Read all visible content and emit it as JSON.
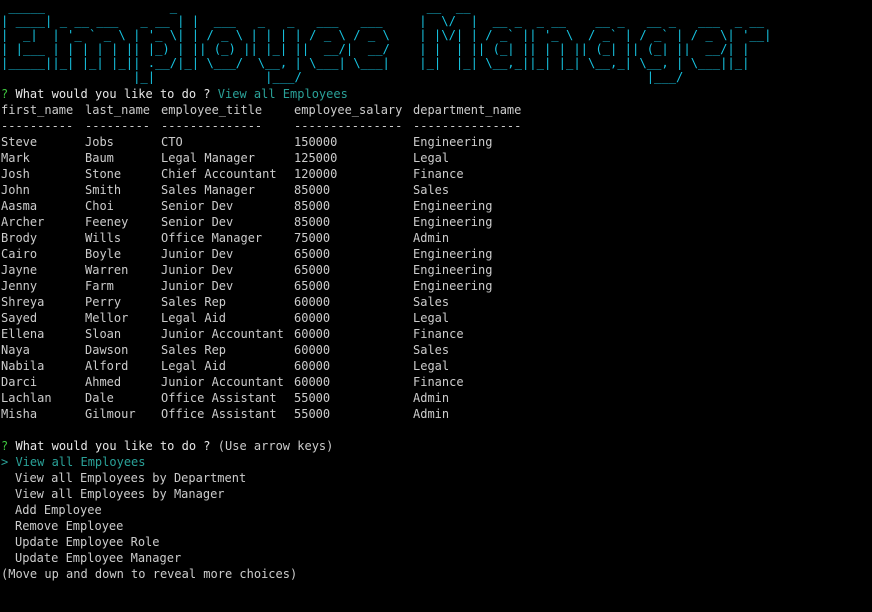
{
  "banner": {
    "lines": [
      " _____                 _                                  __  __",
      "| ____| _ __ ___   _ __ | |  ___   _   _   ___   ___     |  \\/  |  __ _  _ __    __ _   __ _   ___  _ __",
      "|  _|  | '_ ` _ \\ | '_ \\| | / _ \\ | | | | / _ \\ / _ \\    | |\\/| | / _` || '_ \\  / _` | / _` | / _ \\| '__|",
      "| |___ | | | | | || |_) | || (_) || |_| ||  __/|  __/    | |  | || (_| || | | || (_| || (_| ||  __/| |",
      "|_____||_| |_| |_|| .__/|_| \\___/  \\__, | \\___| \\___|    |_|  |_| \\__,_||_| |_| \\__,_| \\__, | \\___||_|",
      "                  |_|               |___/                                               |___/"
    ]
  },
  "prompt1": {
    "mark": "?",
    "question": "What would you like to do ?",
    "answer": "View all Employees"
  },
  "table": {
    "headers": [
      "first_name",
      "last_name",
      "employee_title",
      "employee_salary",
      "department_name"
    ],
    "dividers": [
      "----------",
      "---------",
      "--------------",
      "---------------",
      "---------------"
    ],
    "rows": [
      [
        "Steve",
        "Jobs",
        "CTO",
        "150000",
        "Engineering"
      ],
      [
        "Mark",
        "Baum",
        "Legal Manager",
        "125000",
        "Legal"
      ],
      [
        "Josh",
        "Stone",
        "Chief Accountant",
        "120000",
        "Finance"
      ],
      [
        "John",
        "Smith",
        "Sales Manager",
        "85000",
        "Sales"
      ],
      [
        "Aasma",
        "Choi",
        "Senior Dev",
        "85000",
        "Engineering"
      ],
      [
        "Archer",
        "Feeney",
        "Senior Dev",
        "85000",
        "Engineering"
      ],
      [
        "Brody",
        "Wills",
        "Office Manager",
        "75000",
        "Admin"
      ],
      [
        "Cairo",
        "Boyle",
        "Junior Dev",
        "65000",
        "Engineering"
      ],
      [
        "Jayne",
        "Warren",
        "Junior Dev",
        "65000",
        "Engineering"
      ],
      [
        "Jenny",
        "Farm",
        "Junior Dev",
        "65000",
        "Engineering"
      ],
      [
        "Shreya",
        "Perry",
        "Sales Rep",
        "60000",
        "Sales"
      ],
      [
        "Sayed",
        "Mellor",
        "Legal Aid",
        "60000",
        "Legal"
      ],
      [
        "Ellena",
        "Sloan",
        "Junior Accountant",
        "60000",
        "Finance"
      ],
      [
        "Naya",
        "Dawson",
        "Sales Rep",
        "60000",
        "Sales"
      ],
      [
        "Nabila",
        "Alford",
        "Legal Aid",
        "60000",
        "Legal"
      ],
      [
        "Darci",
        "Ahmed",
        "Junior Accountant",
        "60000",
        "Finance"
      ],
      [
        "Lachlan",
        "Dale",
        "Office Assistant",
        "55000",
        "Admin"
      ],
      [
        "Misha",
        "Gilmour",
        "Office Assistant",
        "55000",
        "Admin"
      ]
    ]
  },
  "prompt2": {
    "mark": "?",
    "question": "What would you like to do ?",
    "hint": "(Use arrow keys)"
  },
  "menu": {
    "pointer": ">",
    "choices": [
      "View all Employees",
      "View all Employees by Department",
      "View all Employees by Manager",
      "Add Employee",
      "Remove Employee",
      "Update Employee Role",
      "Update Employee Manager"
    ],
    "footer": "(Move up and down to reveal more choices)"
  },
  "colors": {
    "banner": "#17c3e0",
    "question_mark": "#3ec33e",
    "selected": "#2aa198",
    "text": "#cccccc",
    "background": "#000000"
  }
}
